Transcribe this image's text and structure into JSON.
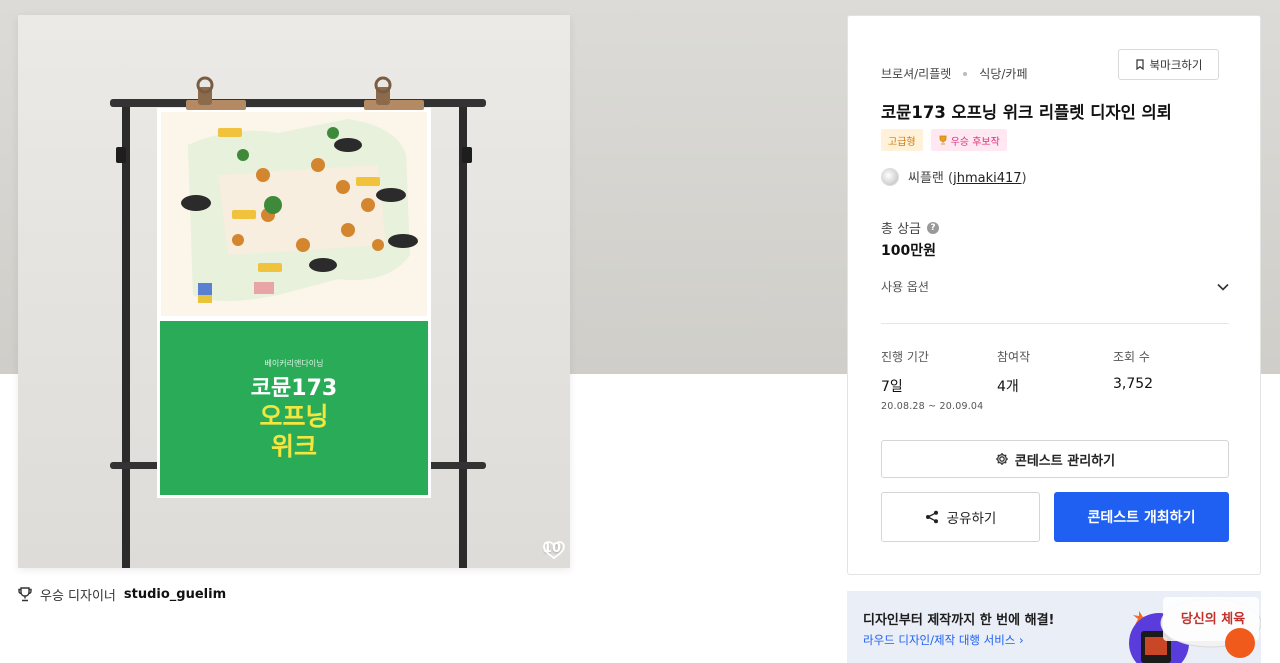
{
  "hero": {
    "poster_small_text": "베이커리앤다이닝",
    "poster_line1": "코뮨173",
    "poster_line2": "오프닝",
    "poster_line3": "위크",
    "like_count": "10"
  },
  "designer": {
    "label": "우승 디자이너",
    "name": "studio_guelim"
  },
  "panel": {
    "category": "브로셔/리플렛",
    "subcategory": "식당/카페",
    "bookmark_label": "북마크하기",
    "title": "코뮨173 오프닝 위크 리플렛 디자인 의뢰",
    "badge_tier": "고급형",
    "badge_award": "우승 후보작",
    "host_name": "씨플랜 (",
    "host_id": "jhmaki417",
    "host_close": ")",
    "prize_label": "총 상금",
    "prize_value": "100만원",
    "options_label": "사용 옵션",
    "stats": [
      {
        "label": "진행 기간",
        "value": "7일",
        "sub": "20.08.28 ~ 20.09.04"
      },
      {
        "label": "참여작",
        "value": "4개",
        "sub": ""
      },
      {
        "label": "조회 수",
        "value": "3,752",
        "sub": ""
      }
    ],
    "manage_label": "콘테스트 관리하기",
    "share_label": "공유하기",
    "host_contest_label": "콘테스트 개최하기"
  },
  "banner": {
    "line1": "디자인부터 제작까지 한 번에 해결!",
    "line2": "라우드 디자인/제작 대행 서비스",
    "logo_text": "당신의 체육"
  },
  "colors": {
    "primary": "#1f5ff2",
    "poster_green": "#2aab57",
    "poster_yellow": "#f3e640"
  }
}
